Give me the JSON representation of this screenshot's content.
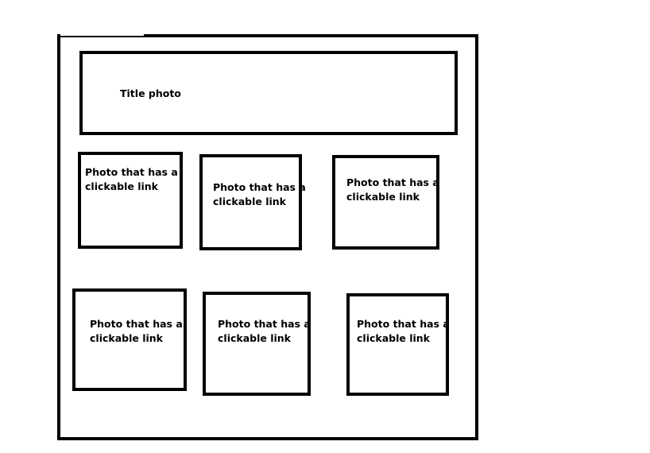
{
  "title_photo": {
    "label": "Title photo"
  },
  "photos": [
    {
      "label": "Photo that has a\nclickable link"
    },
    {
      "label": "Photo that has a\nclickable link"
    },
    {
      "label": "Photo that has a\nclickable link"
    },
    {
      "label": "Photo that has a\nclickable link"
    },
    {
      "label": "Photo that has a\nclickable link"
    },
    {
      "label": "Photo that has a\nclickable link"
    }
  ],
  "colors": {
    "stroke": "#000000",
    "background": "#ffffff"
  }
}
